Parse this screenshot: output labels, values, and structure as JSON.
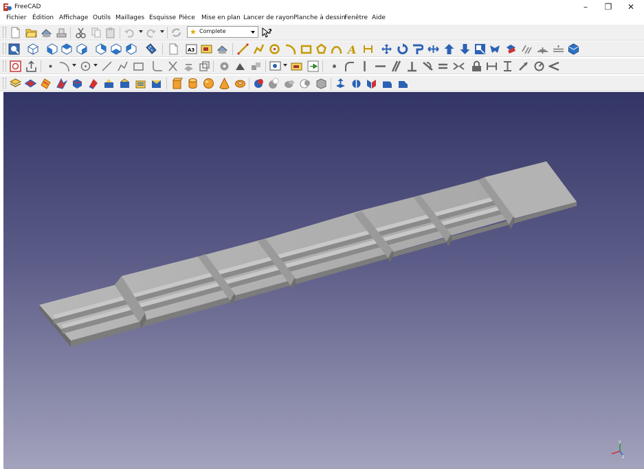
{
  "window": {
    "title": "FreeCAD"
  },
  "menu": [
    "Fichier",
    "Édition",
    "Affichage",
    "Outils",
    "Maillages",
    "Esquisse",
    "Pièce",
    "Mise en plan",
    "Lancer de rayon",
    "Planche à dessin",
    "Fenêtre",
    "Aide"
  ],
  "workbench": {
    "selected": "Complete",
    "icon": "star-icon"
  },
  "controls": {
    "minimize": "–",
    "restore": "❐",
    "close": "✕"
  },
  "axis": {
    "x": "x",
    "y": "y",
    "z": "z"
  },
  "colors": {
    "viewport_top": "#323565",
    "viewport_bottom": "#a3a3bd",
    "part": "#a8a8a8"
  }
}
